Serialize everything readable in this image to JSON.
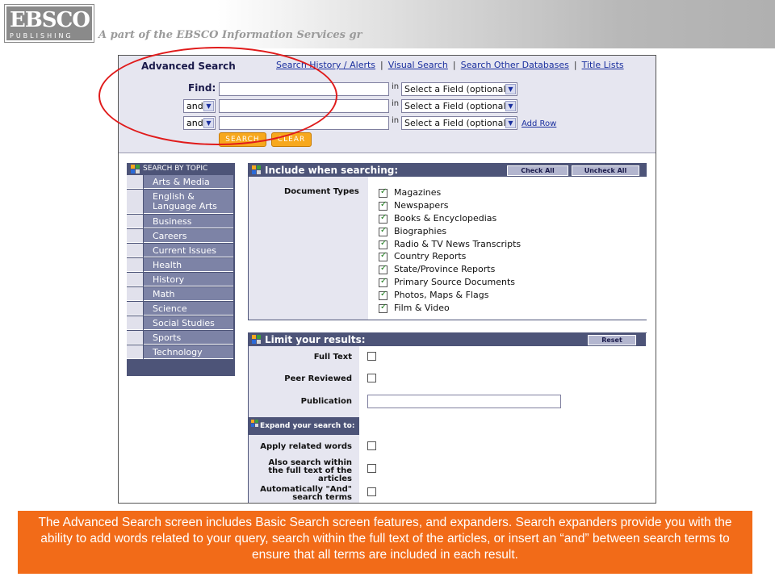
{
  "header": {
    "logo_main": "EBSCO",
    "logo_sub": "PUBLISHING",
    "tagline": "A part of the EBSCO Information Services gr"
  },
  "search": {
    "title": "Advanced Search",
    "links": [
      "Search History / Alerts",
      "Visual Search",
      "Search Other Databases",
      "Title Lists"
    ],
    "separator": "|",
    "find_label": "Find:",
    "in_label": "in",
    "field_placeholder": "Select a Field (optional)",
    "operator": "and",
    "add_row": "Add Row",
    "search_btn": "SEARCH",
    "clear_btn": "CLEAR"
  },
  "topics": {
    "header": "SEARCH BY TOPIC",
    "items": [
      "Arts & Media",
      "English & Language Arts",
      "Business",
      "Careers",
      "Current Issues",
      "Health",
      "History",
      "Math",
      "Science",
      "Social Studies",
      "Sports",
      "Technology"
    ]
  },
  "include": {
    "title": "Include when searching:",
    "check_all": "Check All",
    "uncheck_all": "Uncheck All",
    "doc_types_label": "Document Types",
    "doc_types": [
      "Magazines",
      "Newspapers",
      "Books & Encyclopedias",
      "Biographies",
      "Radio & TV News Transcripts",
      "Country Reports",
      "State/Province Reports",
      "Primary Source Documents",
      "Photos, Maps & Flags",
      "Film & Video"
    ]
  },
  "limit": {
    "title": "Limit your results:",
    "reset": "Reset",
    "full_text": "Full Text",
    "peer_reviewed": "Peer Reviewed",
    "publication": "Publication",
    "expand_title": "Expand your search to:",
    "apply_related": "Apply related words",
    "also_search_1": "Also search within",
    "also_search_2": "the full text of the",
    "also_search_3": "articles",
    "auto_and_1": "Automatically \"And\"",
    "auto_and_2": "search terms"
  },
  "caption": "The Advanced Search screen includes Basic Search screen features, and expanders. Search expanders provide you with the ability to add words related to your query, search within the full text of the articles, or insert an “and” between search terms to ensure that all terms are included in each result.",
  "colors": {
    "nav_dark": "#4d5478",
    "nav_item": "#7d83a6",
    "accent_orange": "#f26b18",
    "button_orange": "#f7a81d",
    "annotation_red": "#e01b1b",
    "link_blue": "#1a2f9e"
  }
}
